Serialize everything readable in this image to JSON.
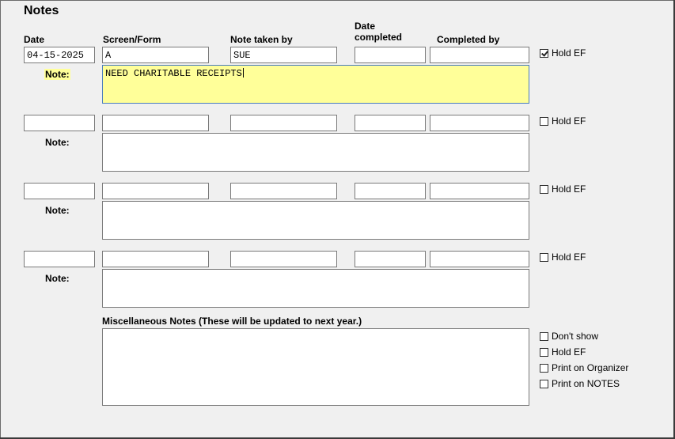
{
  "page": {
    "title": "Notes"
  },
  "headers": {
    "date": "Date",
    "screen_form": "Screen/Form",
    "note_taken_by": "Note taken by",
    "date_completed_line1": "Date",
    "date_completed_line2": "completed",
    "completed_by": "Completed by"
  },
  "rows": [
    {
      "date": "04-15-2025",
      "screen_form": "A",
      "note_taken_by": "SUE",
      "date_completed": "",
      "completed_by": "",
      "note_label": "Note:",
      "note": "NEED CHARITABLE RECEIPTS",
      "hold_ef_label": "Hold EF",
      "hold_ef_checked": true
    },
    {
      "date": "",
      "screen_form": "",
      "note_taken_by": "",
      "date_completed": "",
      "completed_by": "",
      "note_label": "Note:",
      "note": "",
      "hold_ef_label": "Hold EF",
      "hold_ef_checked": false
    },
    {
      "date": "",
      "screen_form": "",
      "note_taken_by": "",
      "date_completed": "",
      "completed_by": "",
      "note_label": "Note:",
      "note": "",
      "hold_ef_label": "Hold EF",
      "hold_ef_checked": false
    },
    {
      "date": "",
      "screen_form": "",
      "note_taken_by": "",
      "date_completed": "",
      "completed_by": "",
      "note_label": "Note:",
      "note": "",
      "hold_ef_label": "Hold EF",
      "hold_ef_checked": false
    }
  ],
  "misc": {
    "label": "Miscellaneous Notes (These will be updated to next year.)",
    "value": "",
    "options": [
      {
        "label": "Don't show",
        "checked": false
      },
      {
        "label": "Hold EF",
        "checked": false
      },
      {
        "label": "Print on Organizer",
        "checked": false
      },
      {
        "label": "Print on NOTES",
        "checked": false
      }
    ]
  }
}
